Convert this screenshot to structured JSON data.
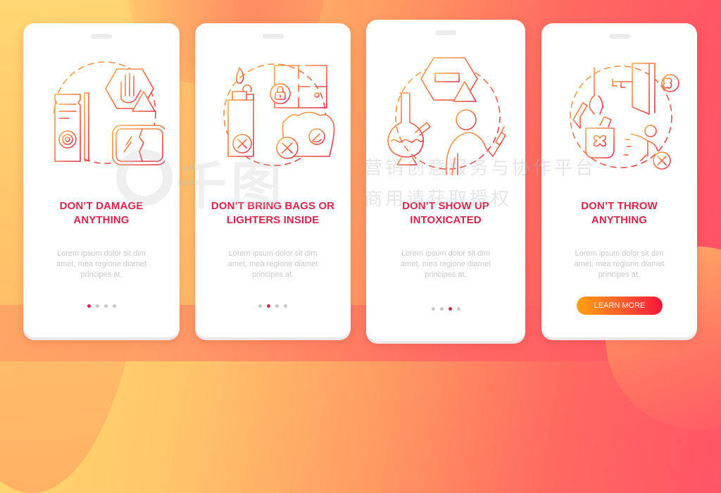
{
  "colors": {
    "title": "#d7264c",
    "body_text": "#c9c9c9",
    "dot_inactive": "#c7c7c7",
    "dot_active": "#d7264c",
    "icon_gradient_start": "#f6a33c",
    "icon_gradient_end": "#e0304f",
    "button_gradient": [
      "#ffa20f",
      "#f2163b"
    ]
  },
  "screens": [
    {
      "title_line1": "DON’T DAMAGE",
      "title_line2": "ANYTHING",
      "body_line1": "Lorem ipsum dolor sit dim",
      "body_line2": "amet, mea regione diamet",
      "body_line3": "principes at.",
      "illustration": "damage-property-icon",
      "active_page": 1,
      "page_count": 4
    },
    {
      "title_line1": "DON’T BRING BAGS OR",
      "title_line2": "LIGHTERS INSIDE",
      "body_line1": "Lorem ipsum dolor sit dim",
      "body_line2": "amet, mea regione diamet",
      "body_line3": "principes at.",
      "illustration": "no-bags-lighters-icon",
      "active_page": 2,
      "page_count": 4
    },
    {
      "title_line1": "DON’T SHOW UP",
      "title_line2": "INTOXICATED",
      "body_line1": "Lorem ipsum dolor sit dim",
      "body_line2": "amet, mea regione diamet",
      "body_line3": "principes at.",
      "illustration": "no-intoxication-icon",
      "active_page": 3,
      "page_count": 4
    },
    {
      "title_line1": "DON’T THROW",
      "title_line2": "ANYTHING",
      "body_line1": "Lorem ipsum dolor sit dim",
      "body_line2": "amet, mea regione diamet",
      "body_line3": "principes at.",
      "illustration": "no-throwing-icon",
      "button_label": "LEARN MORE"
    }
  ],
  "watermark": {
    "logo_text": "千图",
    "line1": "营销创意服务与协作平台",
    "line2": "商用请获取授权"
  }
}
